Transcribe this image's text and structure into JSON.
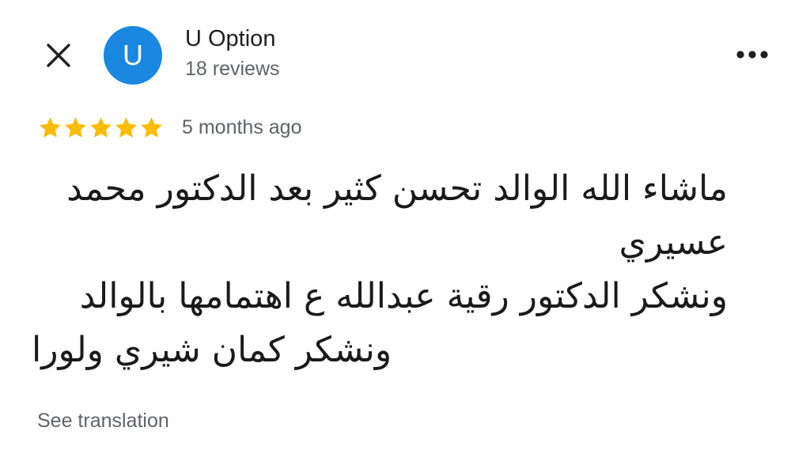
{
  "header": {
    "close_icon": "close-icon",
    "more_icon": "more-horizontal-icon"
  },
  "reviewer": {
    "avatar_letter": "U",
    "avatar_color": "#1a88e0",
    "name": "U Option",
    "reviews_count": "18 reviews"
  },
  "review": {
    "rating": 5,
    "rating_max": 5,
    "star_color": "#fbbc04",
    "date": "5 months ago",
    "text_lines": [
      "ماشاء الله الوالد تحسن كثير بعد الدكتور محمد",
      "عسيري",
      "ونشكر الدكتور رقية عبدالله ع اهتمامها بالوالد",
      "ونشكر كمان شيري ولورا"
    ]
  },
  "footer": {
    "see_translation": "See translation"
  }
}
